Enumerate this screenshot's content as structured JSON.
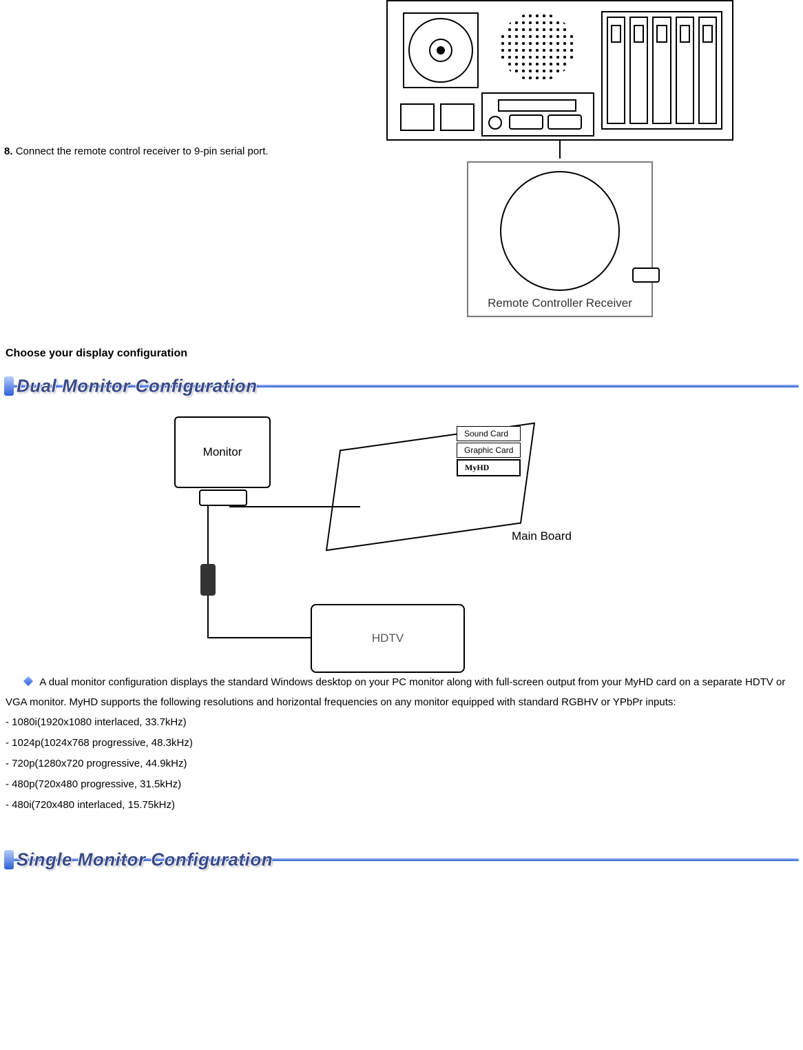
{
  "step": {
    "number": "8.",
    "text": "Connect the remote control receiver to 9-pin serial port."
  },
  "receiver_caption": "Remote Controller Receiver",
  "choose_heading": "Choose your display configuration",
  "banner_dual": "Dual Monitor Configuration",
  "banner_single": "Single Monitor Configuration",
  "dual_fig": {
    "monitor": "Monitor",
    "sound": "Sound Card",
    "graphic": "Graphic Card",
    "myhd": "MyHD",
    "mainboard": "Main Board",
    "hdtv": "HDTV"
  },
  "dual_desc": "A dual monitor configuration displays the standard Windows desktop on your PC monitor along with full-screen output from your MyHD card on a separate HDTV or VGA monitor. MyHD supports the following resolutions and horizontal frequencies on any monitor equipped with standard RGBHV or YPbPr inputs:",
  "resolutions": [
    "- 1080i(1920x1080 interlaced, 33.7kHz)",
    "- 1024p(1024x768 progressive, 48.3kHz)",
    "- 720p(1280x720 progressive, 44.9kHz)",
    "- 480p(720x480 progressive, 31.5kHz)",
    "- 480i(720x480 interlaced, 15.75kHz)"
  ]
}
